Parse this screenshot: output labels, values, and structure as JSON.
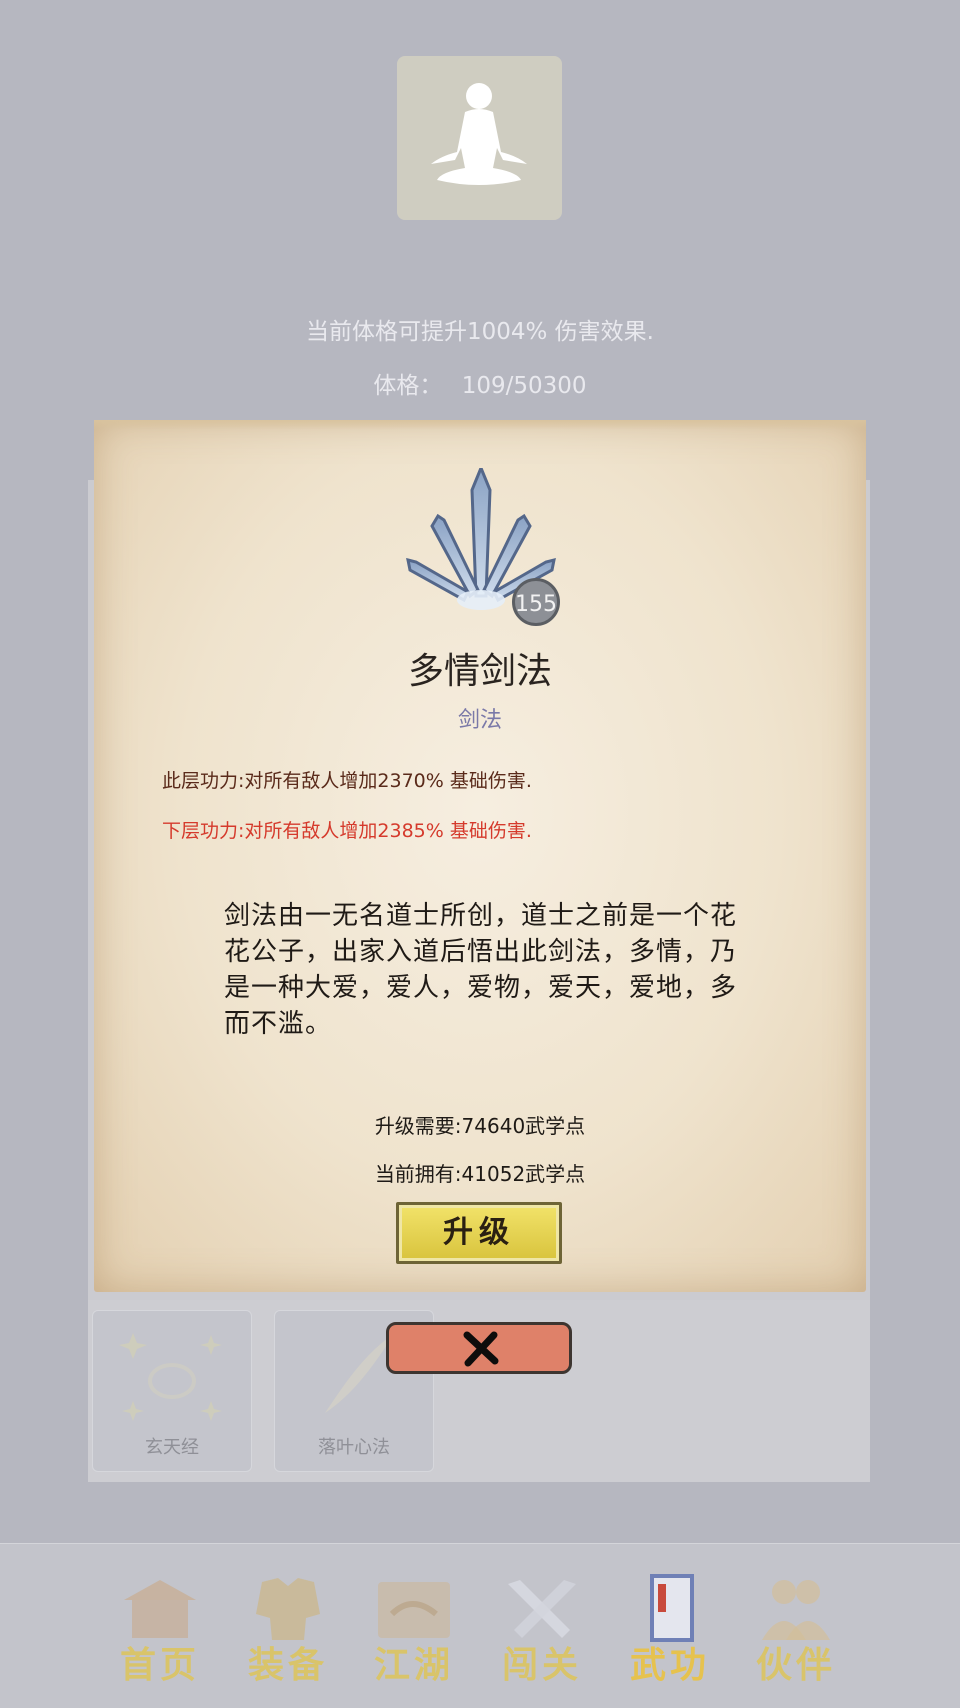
{
  "status": {
    "boost_text": "当前体格可提升1004% 伤害效果.",
    "physique_label": "体格：",
    "physique_value": "109/50300"
  },
  "skill": {
    "name": "多情剑法",
    "type": "剑法",
    "level": "155",
    "current_effect": "此层功力:对所有敌人增加2370% 基础伤害.",
    "next_effect": "下层功力:对所有敌人增加2385% 基础伤害.",
    "description": "剑法由一无名道士所创，道士之前是一个花花公子，出家入道后悟出此剑法，多情，乃是一种大爱，爱人，爱物，爱天，爱地，多而不滥。",
    "upgrade_cost": "升级需要:74640武学点",
    "current_points": "当前拥有:41052武学点",
    "upgrade_label": "升级"
  },
  "background_skills": [
    {
      "label": "玄天经"
    },
    {
      "label": "落叶心法"
    }
  ],
  "nav": [
    {
      "label": "首页",
      "icon": "home-icon"
    },
    {
      "label": "装备",
      "icon": "armor-icon"
    },
    {
      "label": "江湖",
      "icon": "map-scroll-icon"
    },
    {
      "label": "闯关",
      "icon": "swords-icon"
    },
    {
      "label": "武功",
      "icon": "book-icon"
    },
    {
      "label": "伙伴",
      "icon": "partners-icon"
    }
  ],
  "colors": {
    "overlay": "#b6b7c0",
    "next_effect": "#d53a2c",
    "nav_text": "#d9c46a",
    "close_button": "#df8169",
    "upgrade_button": "#e8d54e"
  }
}
